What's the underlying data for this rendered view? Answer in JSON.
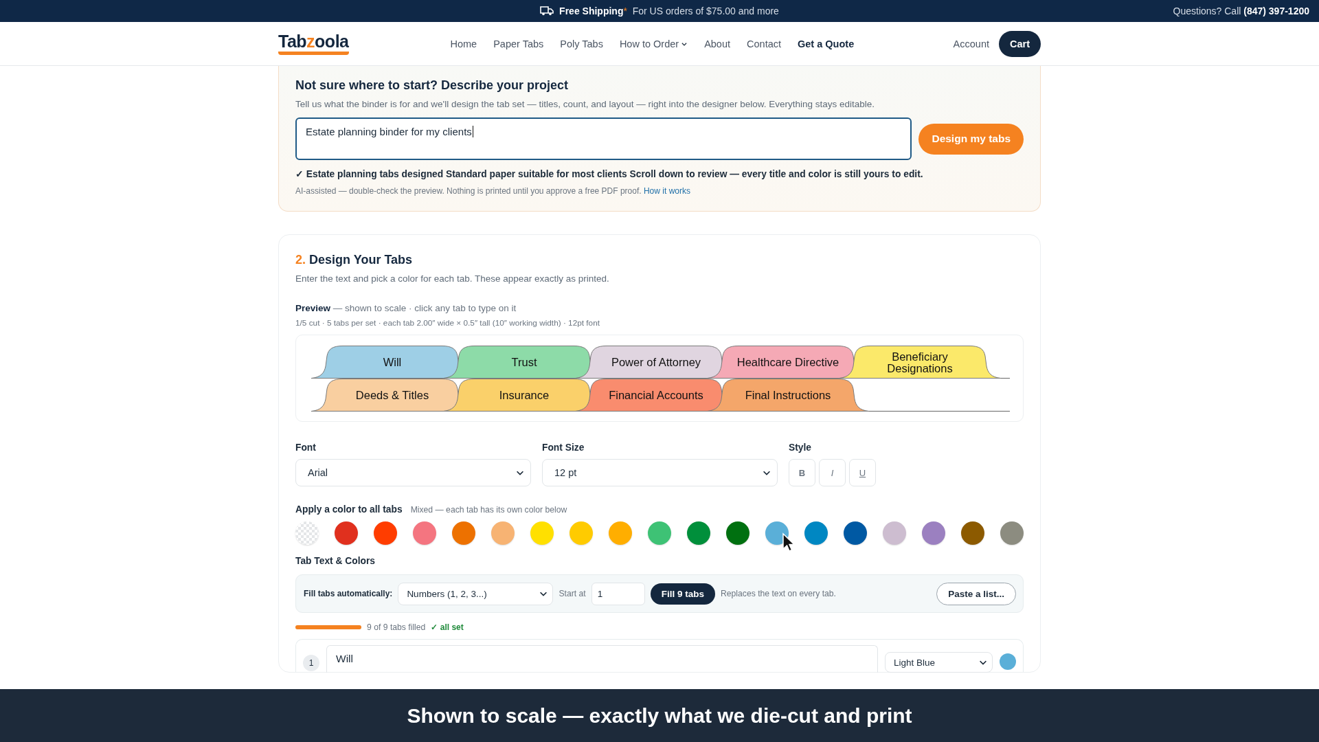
{
  "promo_bar": {
    "highlight": "Free Shipping",
    "mark": "*",
    "text": "For US orders of $75.00 and more",
    "contact_label": "Questions? Call",
    "phone": "(847) 397-1200"
  },
  "header": {
    "logo": {
      "part1": "Tab",
      "part2": "z",
      "part3": "oola"
    },
    "nav": [
      {
        "label": "Home",
        "kind": "link"
      },
      {
        "label": "Paper Tabs",
        "kind": "link"
      },
      {
        "label": "Poly Tabs",
        "kind": "link"
      },
      {
        "label": "How to Order",
        "kind": "menu"
      },
      {
        "label": "About",
        "kind": "link"
      },
      {
        "label": "Contact",
        "kind": "link"
      },
      {
        "label": "Get a Quote",
        "kind": "strong"
      }
    ],
    "account": "Account",
    "cart": "Cart"
  },
  "project": {
    "title": "Not sure where to start? Describe your project",
    "subtitle": "Tell us what the binder is for and we'll design the tab set — titles, count, and layout — right into the designer below. Everything stays editable.",
    "value": "Estate planning binder for my clients",
    "button": "Design my tabs",
    "result": "✓ Estate planning tabs designed Standard paper suitable for most clients Scroll down to review — every title and color is still yours to edit.",
    "note": "AI-assisted — double-check the preview. Nothing is printed until you approve a free PDF proof.",
    "note_link": "How it works"
  },
  "design": {
    "step": "2.",
    "title": "Design Your Tabs",
    "subtitle": "Enter the text and pick a color for each tab. These appear exactly as printed.",
    "preview_label": "Preview",
    "preview_hint": "— shown to scale · click any tab to type on it",
    "spec": "1/5 cut · 5 tabs per set · each tab 2.00″ wide × 0.5″ tall (10″ working width) · 12pt font",
    "preview_rows": [
      [
        {
          "label": "Will",
          "color": "#9ecfe6"
        },
        {
          "label": "Trust",
          "color": "#8ddba8"
        },
        {
          "label": "Power of Attorney",
          "color": "#e0d5e0"
        },
        {
          "label": "Healthcare Directive",
          "color": "#f5a9b5"
        },
        {
          "label": "Beneficiary Designations",
          "color": "#fbe96a"
        }
      ],
      [
        {
          "label": "Deeds & Titles",
          "color": "#f9cfa0"
        },
        {
          "label": "Insurance",
          "color": "#fad06a"
        },
        {
          "label": "Financial Accounts",
          "color": "#f98c6e"
        },
        {
          "label": "Final Instructions",
          "color": "#f4a66a"
        }
      ]
    ],
    "font": {
      "label": "Font",
      "value": "Arial"
    },
    "font_size": {
      "label": "Font Size",
      "value": "12 pt"
    },
    "style": {
      "label": "Style",
      "buttons": [
        {
          "label": "B",
          "kind": "bold",
          "pressed": false
        },
        {
          "label": "I",
          "kind": "italic",
          "pressed": false
        },
        {
          "label": "U",
          "kind": "underline",
          "pressed": false
        }
      ]
    },
    "color_all": {
      "label": "Apply a color to all tabs",
      "hint": "Mixed — each tab has its own color below",
      "swatches": [
        {
          "kind": "none"
        },
        {
          "kind": "color",
          "color": "#e0301e"
        },
        {
          "kind": "color",
          "color": "#ff3d00"
        },
        {
          "kind": "color",
          "color": "#f47580"
        },
        {
          "kind": "color",
          "color": "#ed7100"
        },
        {
          "kind": "color",
          "color": "#f7b373"
        },
        {
          "kind": "color",
          "color": "#ffe000"
        },
        {
          "kind": "color",
          "color": "#ffcb00"
        },
        {
          "kind": "color",
          "color": "#ffae00"
        },
        {
          "kind": "color",
          "color": "#3ec275"
        },
        {
          "kind": "color",
          "color": "#008f3b"
        },
        {
          "kind": "color",
          "color": "#007010"
        },
        {
          "kind": "color",
          "color": "#5aafd8"
        },
        {
          "kind": "color",
          "color": "#0087c2"
        },
        {
          "kind": "color",
          "color": "#0059a3"
        },
        {
          "kind": "color",
          "color": "#cdbdd0"
        },
        {
          "kind": "color",
          "color": "#9b80c0"
        },
        {
          "kind": "color",
          "color": "#8c5a00"
        },
        {
          "kind": "color",
          "color": "#8c8c80"
        }
      ]
    },
    "tab_text": {
      "label": "Tab Text & Colors",
      "fill_label": "Fill tabs automatically:",
      "fill_mode": "Numbers (1, 2, 3...)",
      "start_label": "Start at",
      "start_value": "1",
      "fill_button": "Fill 9 tabs",
      "fill_hint": "Replaces the text on every tab.",
      "paste_button": "Paste a list...",
      "progress": {
        "level": 1,
        "text": "9 of 9 tabs filled",
        "status": "✓ all set"
      },
      "rows": [
        {
          "number": "1",
          "text": "Will",
          "color_name": "Light Blue",
          "color": "#5aafd8"
        }
      ]
    }
  },
  "banner": {
    "text": "Shown to scale — exactly what we die-cut and print"
  }
}
